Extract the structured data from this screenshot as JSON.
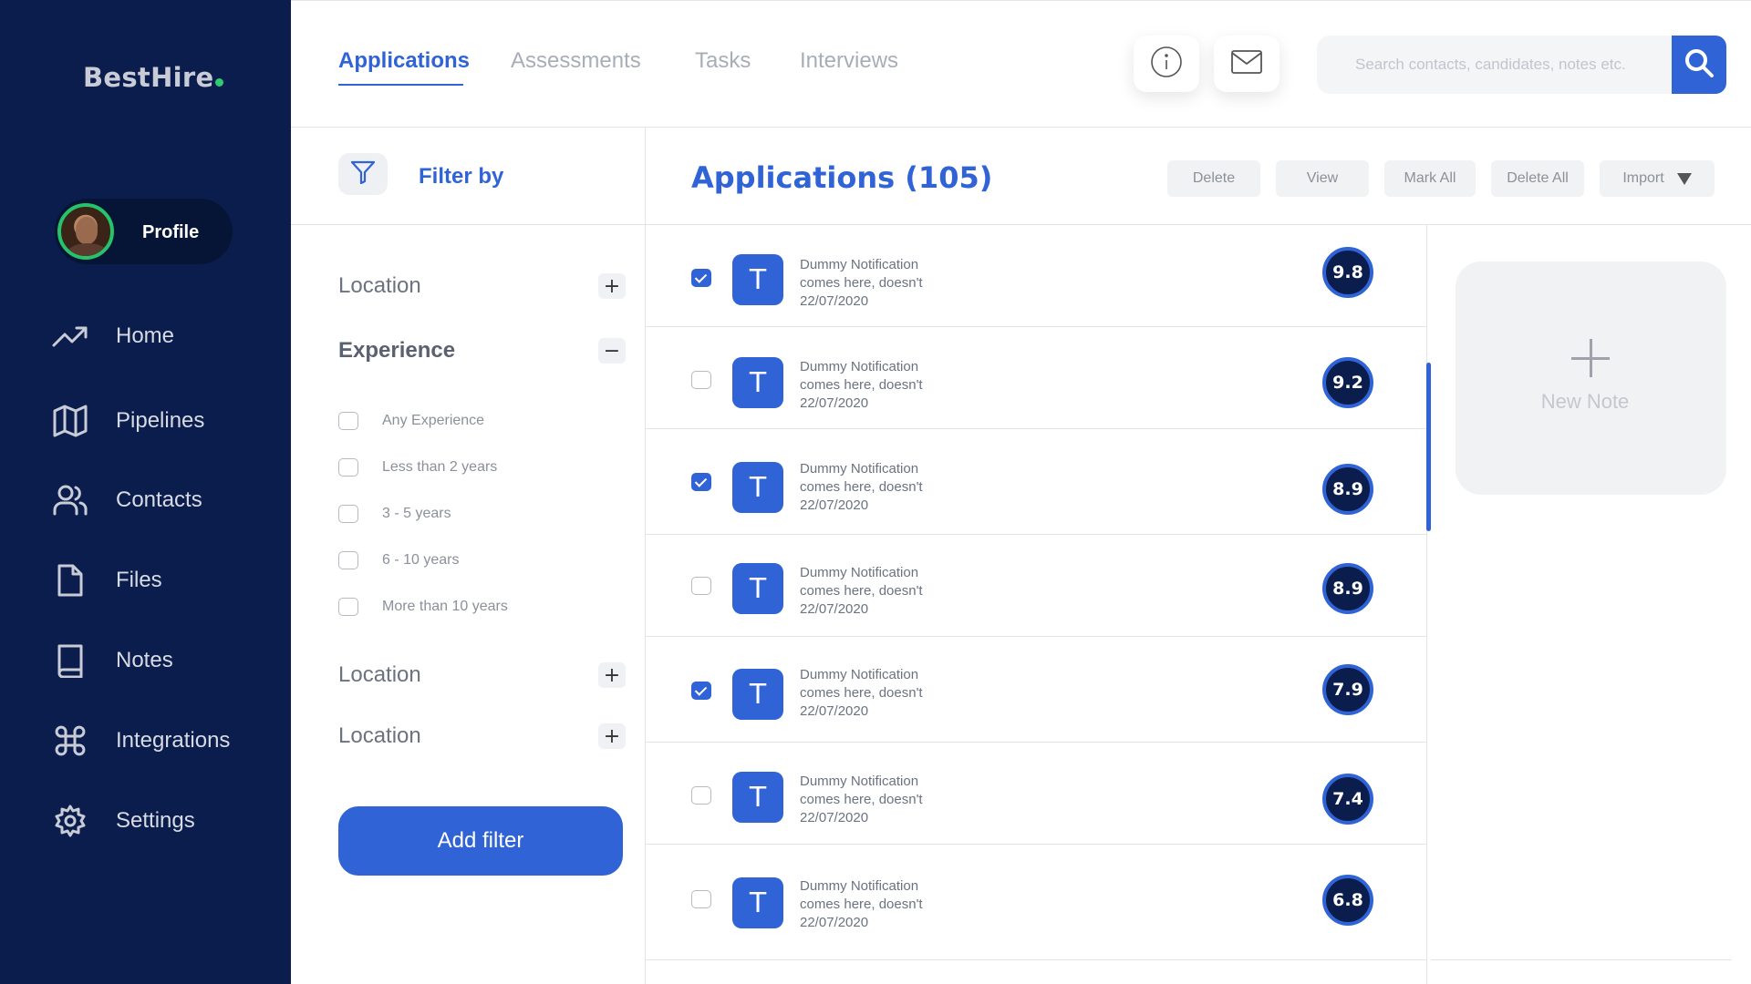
{
  "app": {
    "logo": "BestHire"
  },
  "profile": {
    "label": "Profile"
  },
  "sidebar": {
    "items": [
      {
        "label": "Home",
        "icon": "trending-up-icon"
      },
      {
        "label": "Pipelines",
        "icon": "map-icon"
      },
      {
        "label": "Contacts",
        "icon": "users-icon"
      },
      {
        "label": "Files",
        "icon": "file-icon"
      },
      {
        "label": "Notes",
        "icon": "book-icon"
      },
      {
        "label": "Integrations",
        "icon": "command-icon"
      },
      {
        "label": "Settings",
        "icon": "gear-icon"
      }
    ]
  },
  "topbar": {
    "tabs": [
      {
        "label": "Applications",
        "active": true
      },
      {
        "label": "Assessments",
        "active": false
      },
      {
        "label": "Tasks",
        "active": false
      },
      {
        "label": "Interviews",
        "active": false
      }
    ],
    "search_placeholder": "Search contacts, candidates, notes etc."
  },
  "filter": {
    "title": "Filter by",
    "sections": [
      {
        "label": "Location",
        "toggle": "+"
      },
      {
        "label": "Experience",
        "toggle": "−"
      },
      {
        "label": "Location",
        "toggle": "+"
      },
      {
        "label": "Location",
        "toggle": "+"
      }
    ],
    "experience_options": [
      "Any Experience",
      "Less than 2 years",
      "3 - 5 years",
      "6 - 10 years",
      "More than 10 years"
    ],
    "add_label": "Add filter"
  },
  "main": {
    "title": "Applications (105)",
    "actions": [
      "Delete",
      "View",
      "Mark All",
      "Delete All",
      "Import"
    ],
    "rows": [
      {
        "initial": "T",
        "line1": "Dummy Notification",
        "line2": "comes here, doesn't",
        "date": "22/07/2020",
        "score": "9.8",
        "checked": true
      },
      {
        "initial": "T",
        "line1": "Dummy Notification",
        "line2": "comes here, doesn't",
        "date": "22/07/2020",
        "score": "9.2",
        "checked": false
      },
      {
        "initial": "T",
        "line1": "Dummy Notification",
        "line2": "comes here, doesn't",
        "date": "22/07/2020",
        "score": "8.9",
        "checked": true
      },
      {
        "initial": "T",
        "line1": "Dummy Notification",
        "line2": "comes here, doesn't",
        "date": "22/07/2020",
        "score": "8.9",
        "checked": false
      },
      {
        "initial": "T",
        "line1": "Dummy Notification",
        "line2": "comes here, doesn't",
        "date": "22/07/2020",
        "score": "7.9",
        "checked": true
      },
      {
        "initial": "T",
        "line1": "Dummy Notification",
        "line2": "comes here, doesn't",
        "date": "22/07/2020",
        "score": "7.4",
        "checked": false
      },
      {
        "initial": "T",
        "line1": "Dummy Notification",
        "line2": "comes here, doesn't",
        "date": "22/07/2020",
        "score": "6.8",
        "checked": false
      }
    ]
  },
  "note": {
    "label": "New Note"
  },
  "colors": {
    "sidebar": "#0a1d4c",
    "accent": "#2f63d6",
    "status_green": "#27c36b"
  }
}
